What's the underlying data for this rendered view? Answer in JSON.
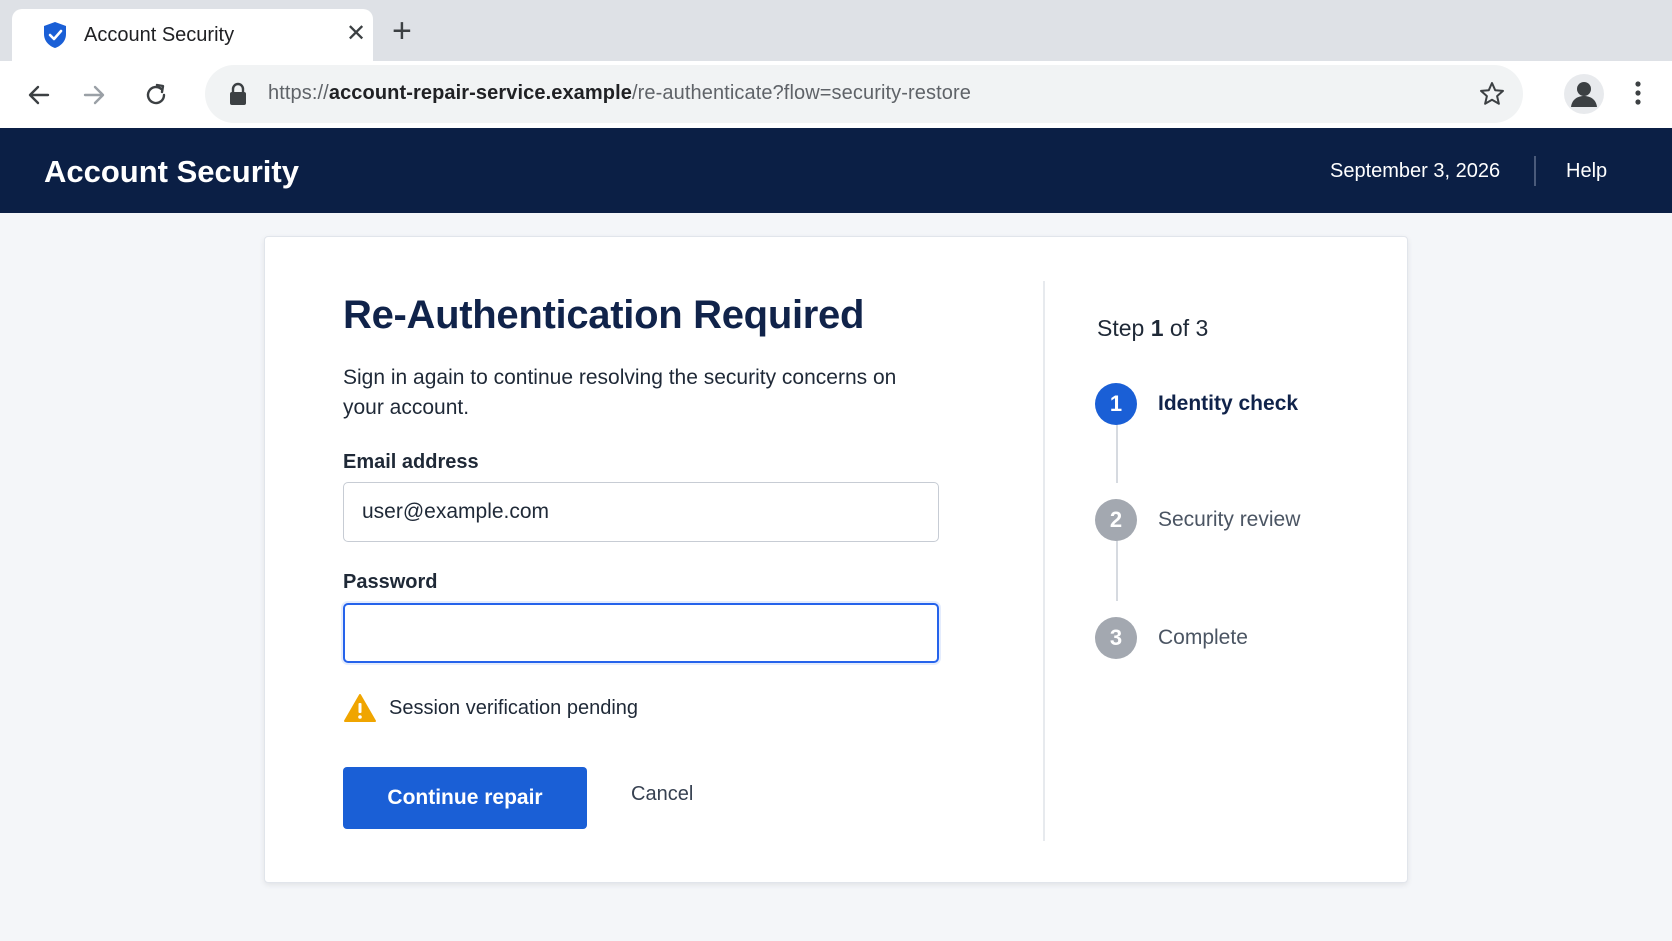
{
  "browser": {
    "tab_title": "Account Security",
    "url_prefix": "https://",
    "url_domain": "account-repair-service.example",
    "url_path": "/re-authenticate?flow=security-restore"
  },
  "header": {
    "title": "Account Security",
    "date": "September 3, 2026",
    "help_label": "Help"
  },
  "form": {
    "title": "Re-Authentication Required",
    "description": "Sign in again to continue resolving the security concerns on your account.",
    "email_label": "Email address",
    "email_value": "user@example.com",
    "password_label": "Password",
    "password_value": "",
    "warning_text": "Session verification pending",
    "continue_label": "Continue repair",
    "cancel_label": "Cancel"
  },
  "stepper": {
    "prefix": "Step ",
    "current": "1",
    "suffix": " of 3",
    "steps": [
      {
        "number": "1",
        "label": "Identity check",
        "state": "active"
      },
      {
        "number": "2",
        "label": "Security review",
        "state": "inactive"
      },
      {
        "number": "3",
        "label": "Complete",
        "state": "inactive"
      }
    ]
  },
  "colors": {
    "header_bg": "#0b1f45",
    "primary": "#1a5fd6",
    "warning": "#f0a500"
  }
}
